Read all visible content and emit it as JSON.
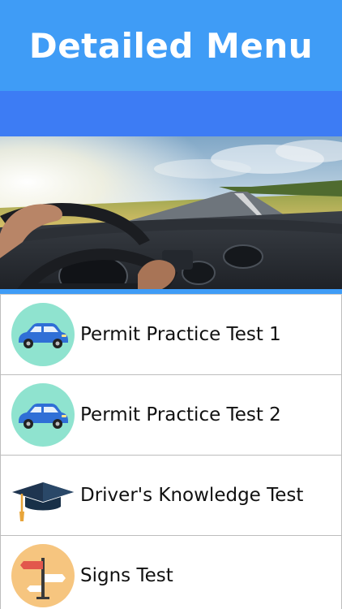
{
  "header": {
    "title": "Detailed Menu"
  },
  "colors": {
    "header_blue": "#3f9cf6",
    "nav_blue": "#3d7cf4",
    "car_badge": "#8fe3cf",
    "signs_badge": "#f6c57f"
  },
  "hero": {
    "image": "car dashboard and road landscape"
  },
  "menu": {
    "items": [
      {
        "label": "Permit Practice Test 1",
        "icon": "blue-car-icon"
      },
      {
        "label": "Permit Practice Test 2",
        "icon": "blue-car-icon"
      },
      {
        "label": "Driver's Knowledge Test",
        "icon": "graduation-cap-icon"
      },
      {
        "label": "Signs Test",
        "icon": "signpost-icon"
      }
    ]
  }
}
